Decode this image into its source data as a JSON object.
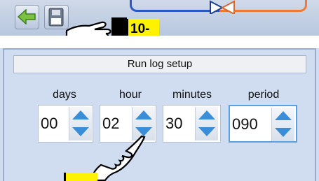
{
  "toolbar": {
    "back_icon": "arrow-left-icon",
    "save_icon": "save-icon",
    "callout_label": "10-"
  },
  "run_log_setup": {
    "title": "Run log setup",
    "fields": [
      {
        "label": "days",
        "value": "00"
      },
      {
        "label": "hour",
        "value": "02"
      },
      {
        "label": "minutes",
        "value": "30"
      },
      {
        "label": "period",
        "value": "090"
      }
    ]
  },
  "colors": {
    "panel_bg": "#d0dcef",
    "arrow_blue": "#3a8dd8",
    "pipe_blue": "#2a58c4",
    "pipe_orange": "#f07a33",
    "callout_yellow": "#fff200"
  }
}
